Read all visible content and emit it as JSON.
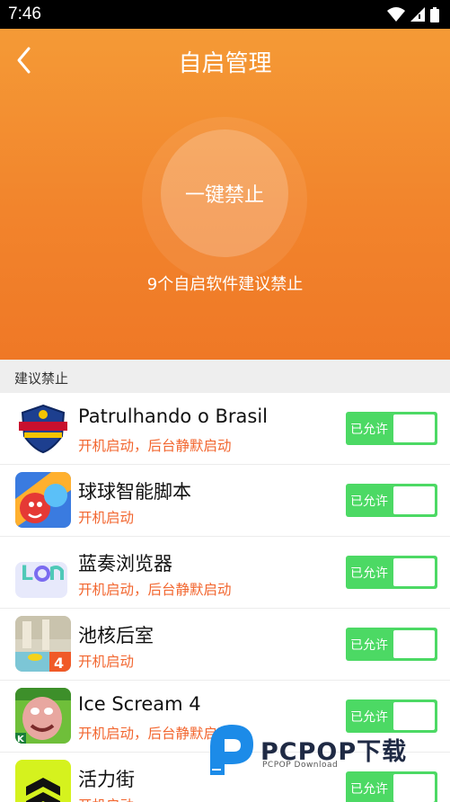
{
  "status_bar": {
    "time": "7:46"
  },
  "header": {
    "title": "自启管理",
    "action_label": "一键禁止",
    "subtitle": "9个自启软件建议禁止",
    "gradient_top": "#f49a36",
    "gradient_bottom": "#ef7826"
  },
  "section": {
    "title": "建议禁止"
  },
  "apps": [
    {
      "name": "Patrulhando o Brasil",
      "desc": "开机启动，后台静默启动",
      "toggle": "已允许",
      "icon": "patrulhando-badge-icon"
    },
    {
      "name": "球球智能脚本",
      "desc": "开机启动",
      "toggle": "已允许",
      "icon": "ball-game-icon"
    },
    {
      "name": "蓝奏浏览器",
      "desc": "开机启动，后台静默启动",
      "toggle": "已允许",
      "icon": "lanzou-browser-icon"
    },
    {
      "name": "池核后室",
      "desc": "开机启动",
      "toggle": "已允许",
      "icon": "pool-room-icon"
    },
    {
      "name": "Ice Scream 4",
      "desc": "开机启动，后台静默启动",
      "toggle": "已允许",
      "icon": "ice-scream-icon"
    },
    {
      "name": "活力街",
      "desc": "开机启动",
      "toggle": "已允许",
      "icon": "chevron-app-icon"
    }
  ],
  "watermark": {
    "text": "PCPOP下载",
    "sub": "PCPOP Download"
  },
  "colors": {
    "accent": "#f2842c",
    "toggle_on": "#4cd964",
    "desc": "#f2662f"
  }
}
